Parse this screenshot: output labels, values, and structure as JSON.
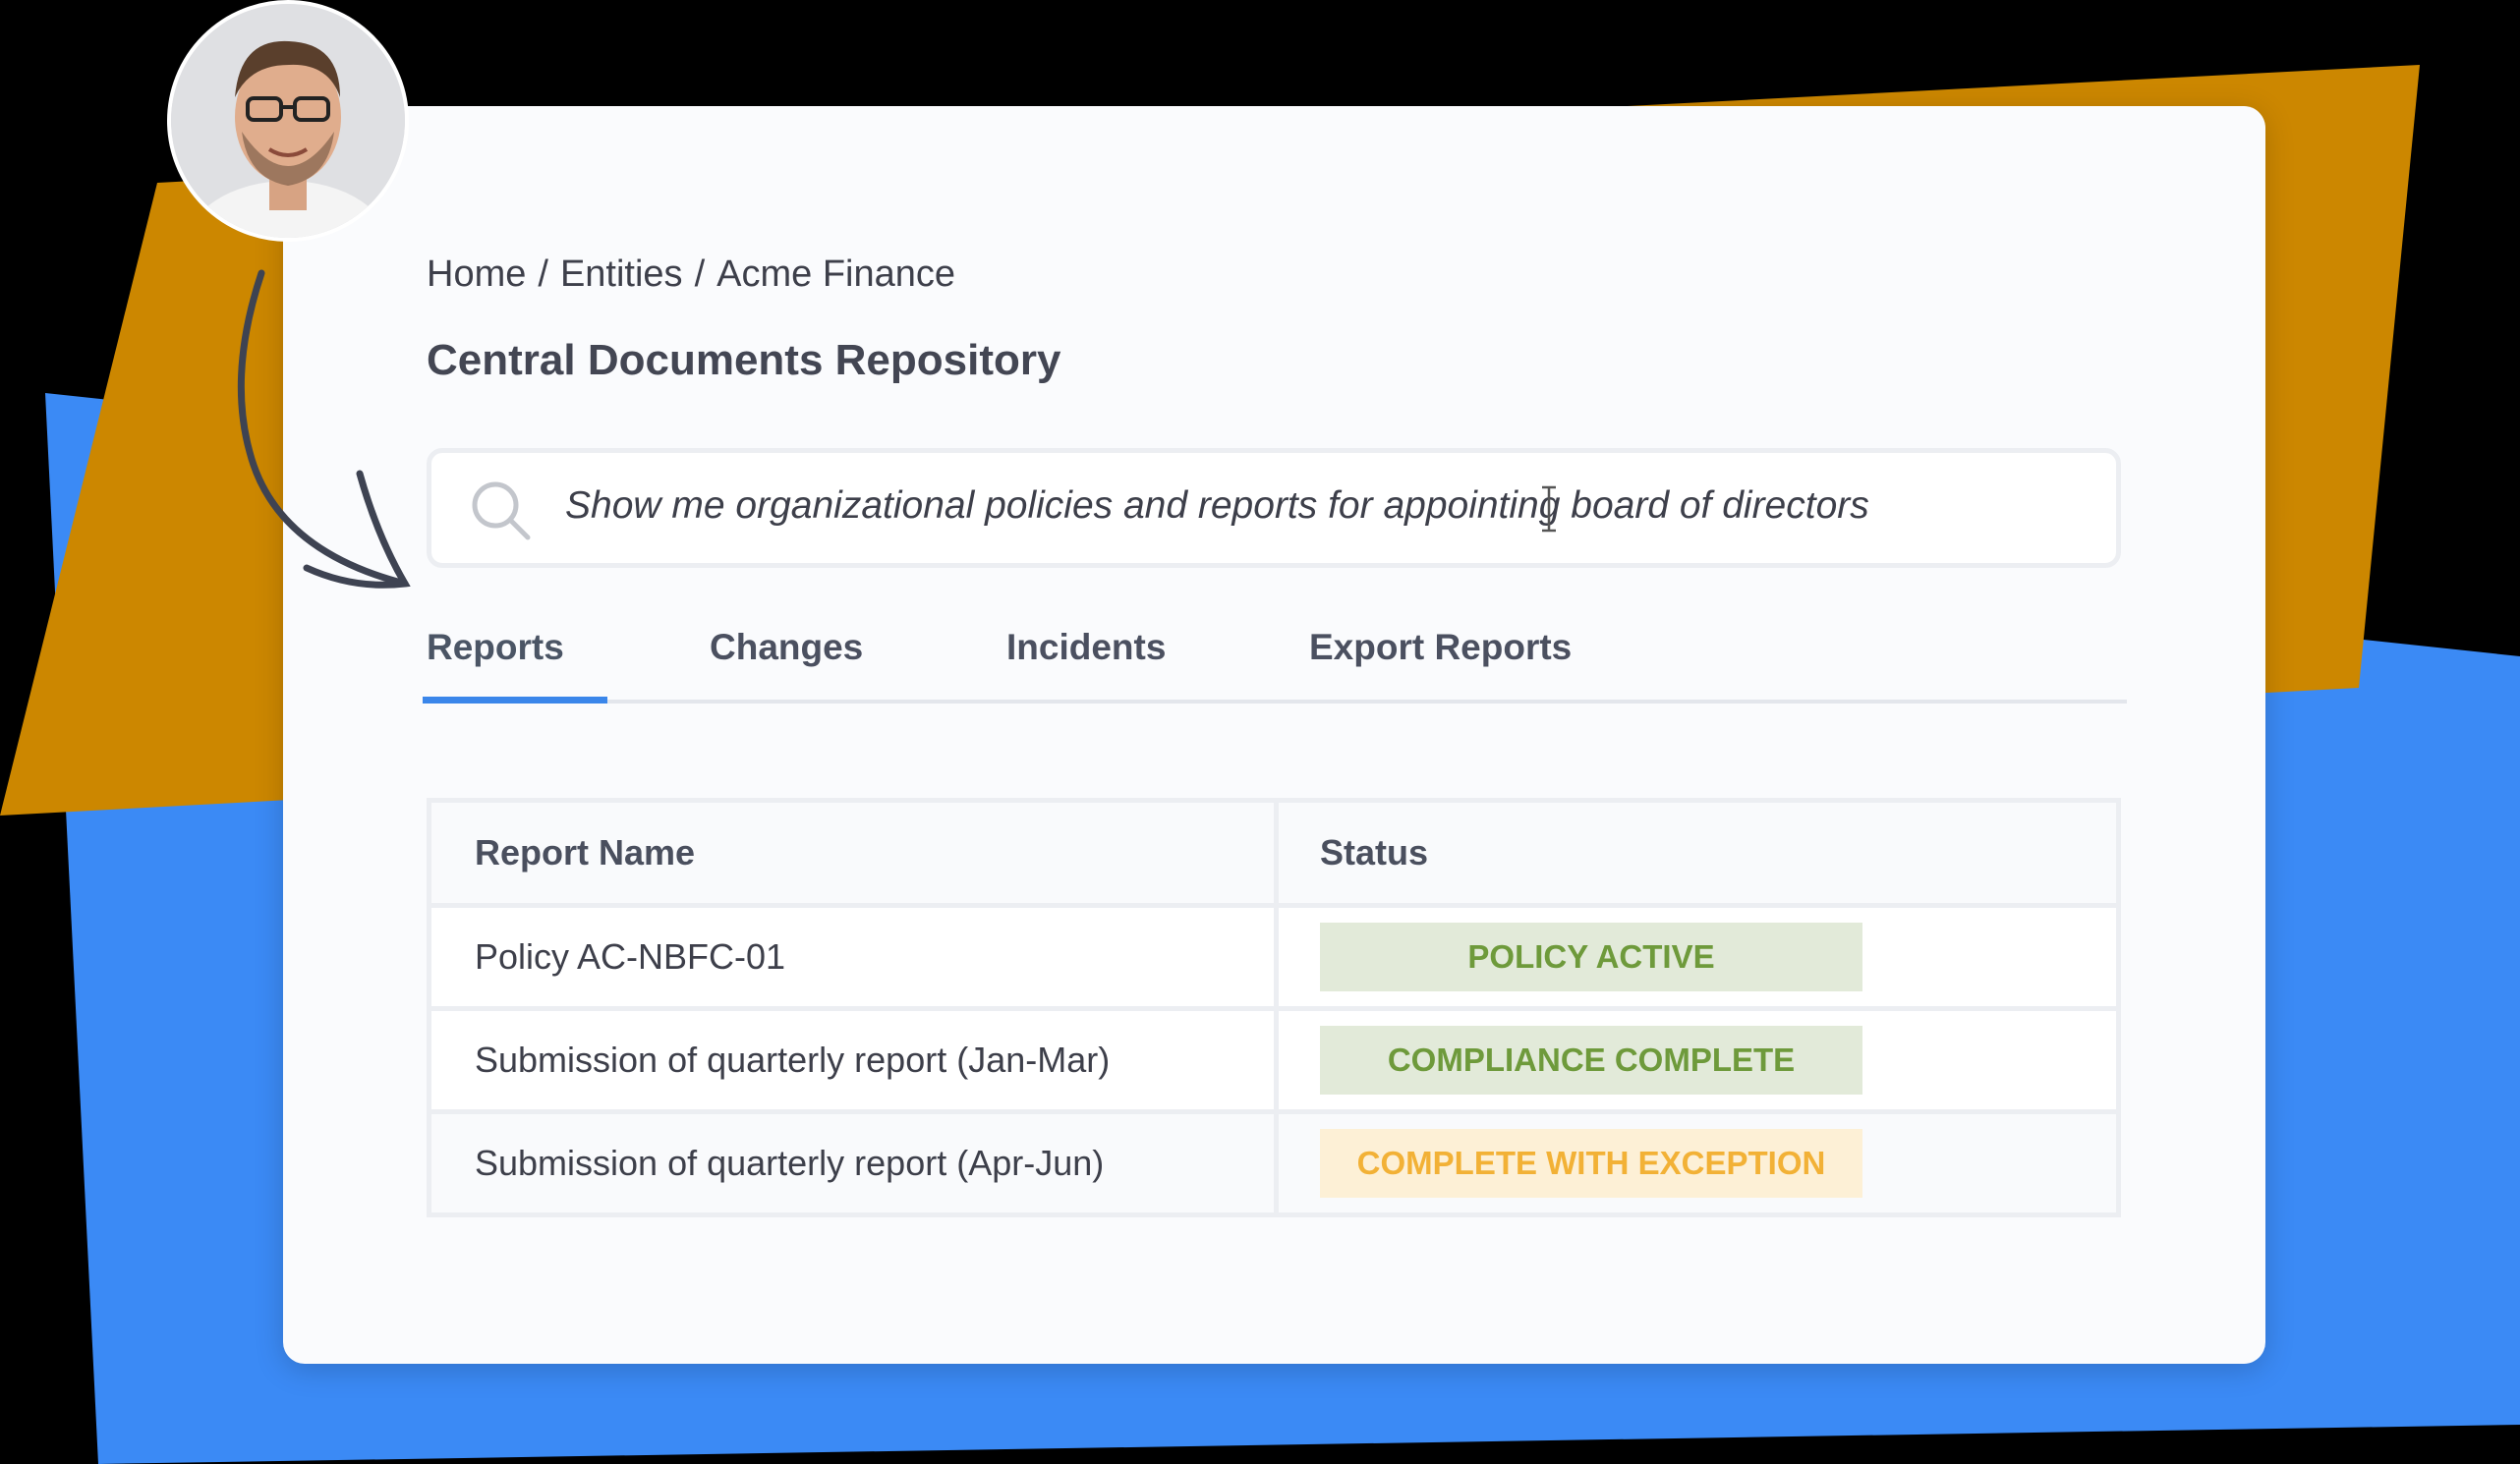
{
  "breadcrumb": {
    "items": [
      "Home",
      "Entities",
      "Acme Finance"
    ],
    "separator": "/"
  },
  "page": {
    "title": "Central Documents Repository"
  },
  "search": {
    "value": "Show me organizational policies and reports for appointing board of directors",
    "icon": "search-icon"
  },
  "tabs": [
    {
      "label": "Reports",
      "active": true
    },
    {
      "label": "Changes",
      "active": false
    },
    {
      "label": "Incidents",
      "active": false
    },
    {
      "label": "Export Reports",
      "active": false
    }
  ],
  "table": {
    "headers": [
      "Report Name",
      "Status"
    ],
    "rows": [
      {
        "name": "Policy AC-NBFC-01",
        "status": "POLICY ACTIVE",
        "status_color": "green"
      },
      {
        "name": "Submission of quarterly report (Jan-Mar)",
        "status": "COMPLIANCE COMPLETE",
        "status_color": "green"
      },
      {
        "name": "Submission of quarterly report (Apr-Jun)",
        "status": "COMPLETE WITH EXCEPTION",
        "status_color": "orange"
      }
    ]
  },
  "colors": {
    "accent_blue": "#3a86ea",
    "background_blue": "#3b8af5",
    "background_orange": "#cc8700",
    "status_green_bg": "#e2ead9",
    "status_green_text": "#6e9a3b",
    "status_orange_bg": "#fdf0d6",
    "status_orange_text": "#f2b136"
  }
}
